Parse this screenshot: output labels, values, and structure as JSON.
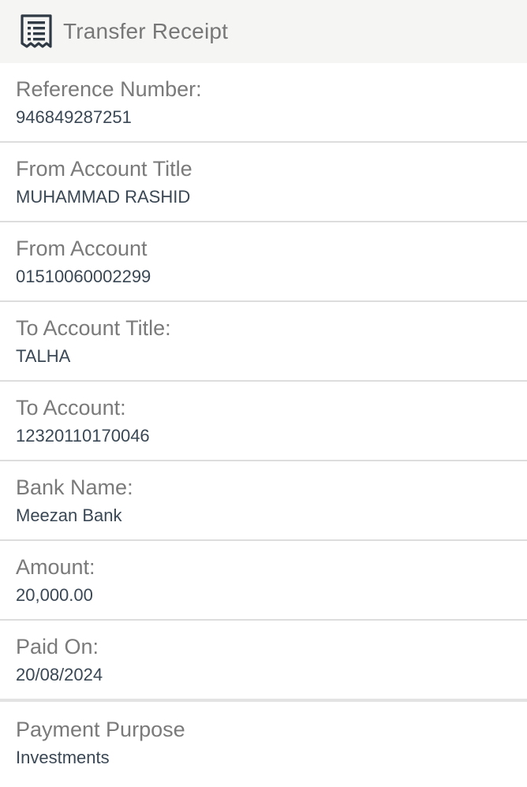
{
  "header": {
    "icon": "receipt-icon",
    "title": "Transfer Receipt"
  },
  "fields": [
    {
      "label": "Reference Number:",
      "value": "946849287251"
    },
    {
      "label": "From Account Title",
      "value": "MUHAMMAD RASHID"
    },
    {
      "label": "From Account",
      "value": "01510060002299"
    },
    {
      "label": "To Account Title:",
      "value": "TALHA"
    },
    {
      "label": "To Account:",
      "value": "12320110170046"
    },
    {
      "label": "Bank Name:",
      "value": "Meezan Bank"
    },
    {
      "label": "Amount:",
      "value": "20,000.00"
    },
    {
      "label": "Paid On:",
      "value": "20/08/2024"
    },
    {
      "label": "Payment Purpose",
      "value": "Investments"
    }
  ]
}
